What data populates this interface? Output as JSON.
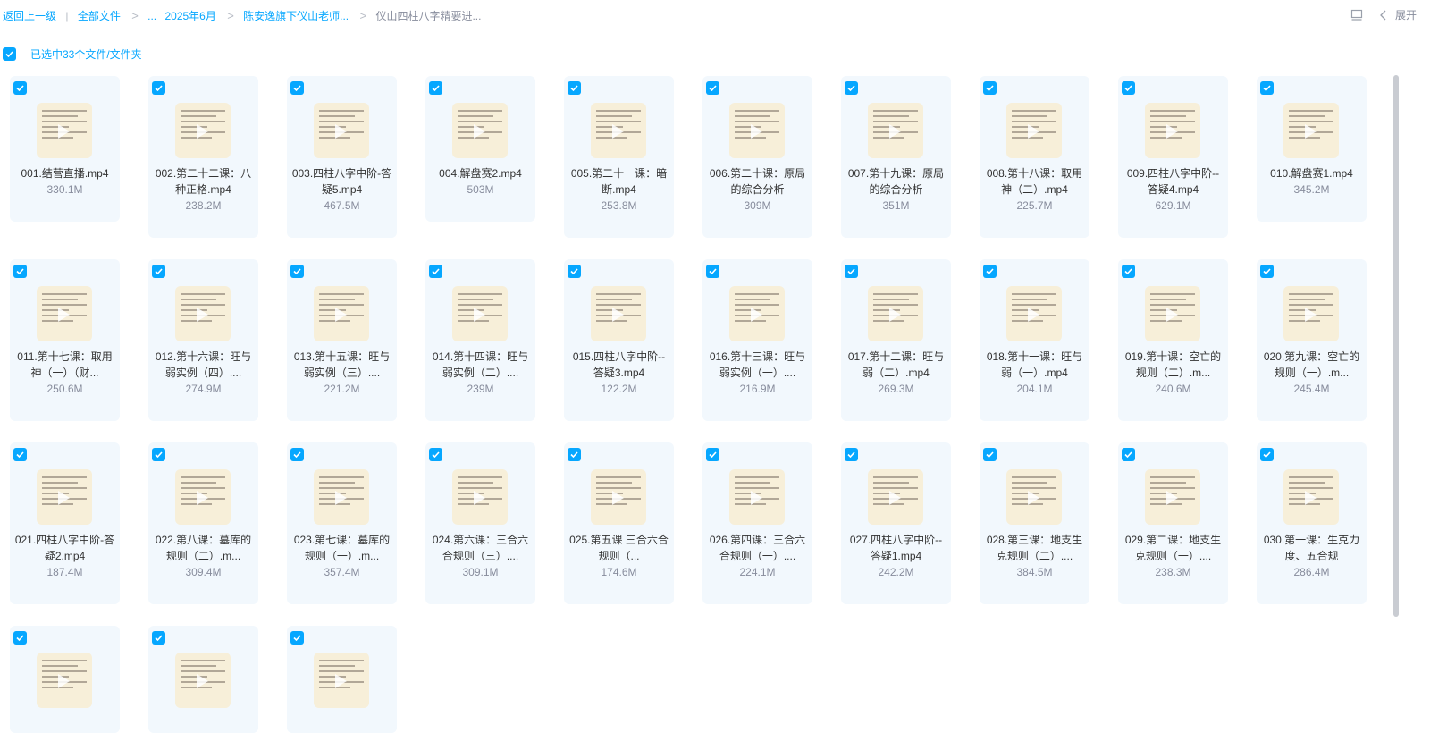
{
  "breadcrumb": {
    "back": "返回上一级",
    "all_files": "全部文件",
    "ellipsis": "...",
    "items": [
      "2025年6月",
      "陈安逸旗下仪山老师...",
      "仪山四柱八字精要进..."
    ],
    "separator": "|",
    "chevron": ">"
  },
  "toolbar": {
    "expand_label": "展开",
    "panel_icon": "panel-icon",
    "chevron_icon": "chevron-left-icon"
  },
  "selection": {
    "text": "已选中33个文件/文件夹",
    "checked": true
  },
  "colors": {
    "accent": "#06a7ff",
    "card_bg": "#f2f8fd",
    "muted": "#878c9c"
  },
  "files": [
    {
      "name": "001.结营直播.mp4",
      "size": "330.1M"
    },
    {
      "name": "002.第二十二课：八种正格.mp4",
      "size": "238.2M"
    },
    {
      "name": "003.四柱八字中阶-答疑5.mp4",
      "size": "467.5M"
    },
    {
      "name": "004.解盘赛2.mp4",
      "size": "503M"
    },
    {
      "name": "005.第二十一课：暗断.mp4",
      "size": "253.8M"
    },
    {
      "name": "006.第二十课：原局的综合分析",
      "size": "309M"
    },
    {
      "name": "007.第十九课：原局的综合分析",
      "size": "351M"
    },
    {
      "name": "008.第十八课：取用神（二）.mp4",
      "size": "225.7M"
    },
    {
      "name": "009.四柱八字中阶--答疑4.mp4",
      "size": "629.1M"
    },
    {
      "name": "010.解盘赛1.mp4",
      "size": "345.2M"
    },
    {
      "name": "011.第十七课：取用神（一）（财...",
      "size": "250.6M"
    },
    {
      "name": "012.第十六课：旺与弱实例（四）....",
      "size": "274.9M"
    },
    {
      "name": "013.第十五课：旺与弱实例（三）....",
      "size": "221.2M"
    },
    {
      "name": "014.第十四课：旺与弱实例（二）....",
      "size": "239M"
    },
    {
      "name": "015.四柱八字中阶--答疑3.mp4",
      "size": "122.2M"
    },
    {
      "name": "016.第十三课：旺与弱实例（一）....",
      "size": "216.9M"
    },
    {
      "name": "017.第十二课：旺与弱（二）.mp4",
      "size": "269.3M"
    },
    {
      "name": "018.第十一课：旺与弱（一）.mp4",
      "size": "204.1M"
    },
    {
      "name": "019.第十课：空亡的规则（二）.m...",
      "size": "240.6M"
    },
    {
      "name": "020.第九课：空亡的规则（一）.m...",
      "size": "245.4M"
    },
    {
      "name": "021.四柱八字中阶-答疑2.mp4",
      "size": "187.4M"
    },
    {
      "name": "022.第八课：墓库的规则（二）.m...",
      "size": "309.4M"
    },
    {
      "name": "023.第七课：墓库的规则（一）.m...",
      "size": "357.4M"
    },
    {
      "name": "024.第六课：三合六合规则（三）....",
      "size": "309.1M"
    },
    {
      "name": "025.第五课 三合六合规则（...",
      "size": "174.6M"
    },
    {
      "name": "026.第四课：三合六合规则（一）....",
      "size": "224.1M"
    },
    {
      "name": "027.四柱八字中阶--答疑1.mp4",
      "size": "242.2M"
    },
    {
      "name": "028.第三课：地支生克规则（二）....",
      "size": "384.5M"
    },
    {
      "name": "029.第二课：地支生克规则（一）....",
      "size": "238.3M"
    },
    {
      "name": "030.第一课：生克力度、五合规",
      "size": "286.4M"
    },
    {
      "name": "",
      "size": ""
    },
    {
      "name": "",
      "size": ""
    },
    {
      "name": "",
      "size": ""
    }
  ]
}
